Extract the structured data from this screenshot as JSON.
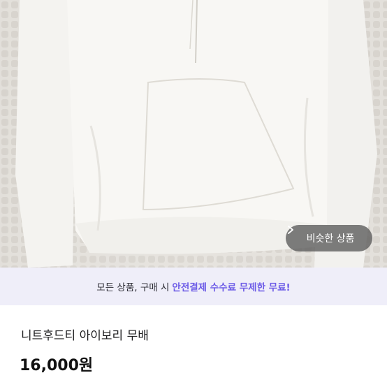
{
  "product_photo": {
    "alt": "",
    "colors": {
      "background": "#e6e3de",
      "garment": "#f7f6f3"
    }
  },
  "similar_button": {
    "label": "비슷한 상품",
    "icon": "chevron-right-icon"
  },
  "promo_banner": {
    "prefix": "모든 상품, 구매 시",
    "highlight": "안전결제 수수료 무제한 무료!",
    "accent_color": "#6d5ce7"
  },
  "product": {
    "title": "니트후드티 아이보리 무배",
    "price": "16,000원"
  }
}
